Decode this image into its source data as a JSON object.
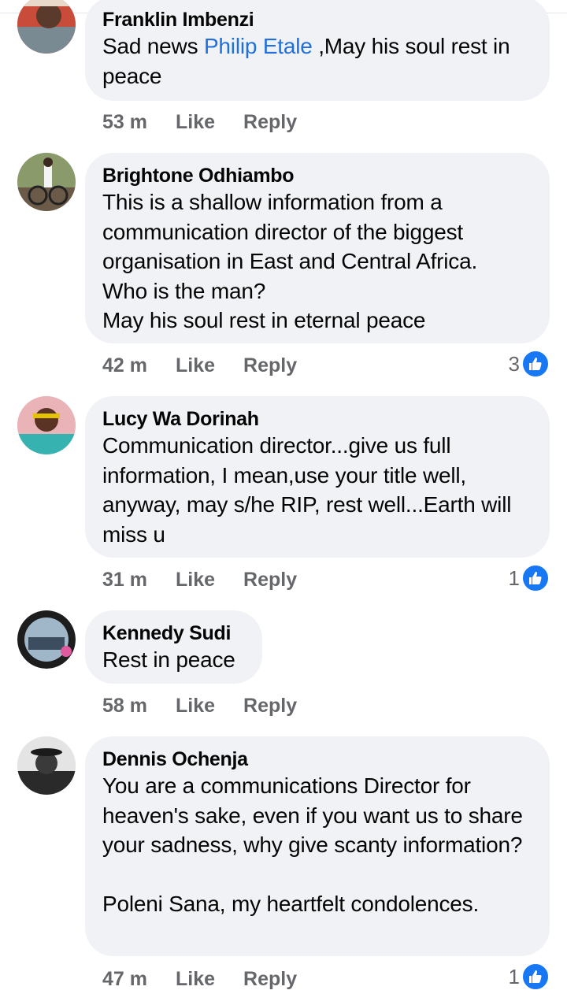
{
  "comments": [
    {
      "author": "Franklin Imbenzi",
      "text_before": "Sad news ",
      "mention": "Philip Etale",
      "text_after": " ,May his soul rest in peace",
      "time": "53 m",
      "like_label": "Like",
      "reply_label": "Reply"
    },
    {
      "author": "Brightone Odhiambo",
      "text": "This is a shallow information from a communication director of the biggest organisation in East and Central Africa.\nWho is the man?\nMay his soul rest in eternal peace",
      "time": "42 m",
      "like_label": "Like",
      "reply_label": "Reply",
      "reaction_count": "3"
    },
    {
      "author": "Lucy Wa Dorinah",
      "text": "Communication director...give us full information, I mean,use your title well, anyway, may s/he RIP, rest well...Earth will miss u",
      "time": "31 m",
      "like_label": "Like",
      "reply_label": "Reply",
      "reaction_count": "1"
    },
    {
      "author": "Kennedy Sudi",
      "text": "Rest in peace",
      "time": "58 m",
      "like_label": "Like",
      "reply_label": "Reply"
    },
    {
      "author": "Dennis Ochenja",
      "text": "You are a communications Director for heaven's sake, even if you want us to share your sadness, why give scanty information?\n\nPoleni Sana, my heartfelt condolences.",
      "time": "47 m",
      "like_label": "Like",
      "reply_label": "Reply",
      "reaction_count": "1"
    }
  ],
  "colors": {
    "bubble": "#f0f2f5",
    "mention": "#216fdb",
    "meta": "#65676b",
    "like_badge": "#1877f2"
  },
  "icons": {
    "reaction": "thumbs-up-icon"
  }
}
